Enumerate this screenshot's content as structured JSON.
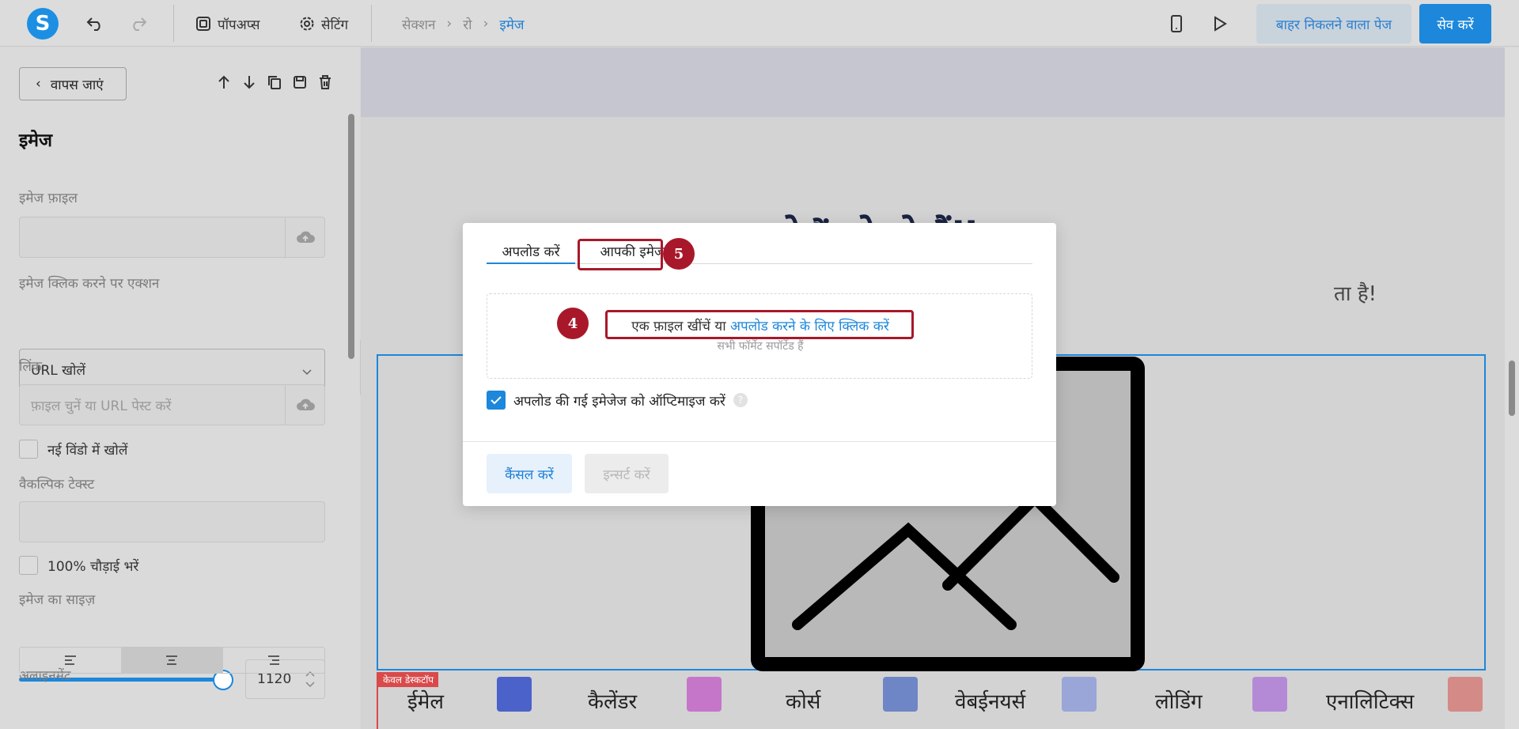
{
  "topbar": {
    "logo_letter": "S",
    "popups_label": "पॉपअप्स",
    "settings_label": "सेटिंग",
    "breadcrumb": [
      "सेक्शन",
      "रो",
      "इमेज"
    ],
    "exit_page_label": "बाहर निकलने वाला पेज",
    "save_label": "सेव करें"
  },
  "left_panel": {
    "back_label": "वापस जाएं",
    "title": "इमेज",
    "image_file_label": "इमेज फ़ाइल",
    "click_action_label": "इमेज क्लिक करने पर एक्शन",
    "click_action_value": "URL खोलें",
    "link_label": "लिंक",
    "link_placeholder": "फ़ाइल चुनें या URL पेस्ट करें",
    "new_window_label": "नई विंडो में खोलें",
    "alt_text_label": "वैकल्पिक टेक्स्ट",
    "full_width_label": "100% चौड़ाई भरें",
    "image_size_label": "इमेज का साइज़",
    "image_size_value": "1120",
    "image_size_fraction": 1.0,
    "alignment_label": "अलाइनमेंट",
    "alignment_selected": "center"
  },
  "canvas": {
    "heading_fragment": "ो ैं ो ो हैंjj",
    "subtext_fragment": "ता है!",
    "strip_badge": "केवल डेस्कटॉप",
    "strip_items": [
      "ईमेल",
      "कैलेंडर",
      "कोर्स",
      "वेबईनयर्स",
      "लोडिंग",
      "एनालिटिक्स"
    ]
  },
  "modal": {
    "tab_upload": "अपलोड करें",
    "tab_your_images": "आपकी इमेज",
    "dropzone_text": "एक फ़ाइल खींचें या ",
    "dropzone_link": "अपलोड करने के लिए क्लिक करें",
    "dropzone_sub": "सभी फॉर्मेट सपॉर्टेड हैं",
    "optimize_label": "अपलोड की गई इमेजेज को ऑप्टिमाइज करें",
    "optimize_checked": true,
    "help_glyph": "?",
    "cancel_label": "कैंसल करें",
    "insert_label": "इन्सर्ट करें",
    "marker_4": "4",
    "marker_5": "5"
  },
  "colors": {
    "accent": "#1c87db",
    "callout": "#a8182a"
  }
}
